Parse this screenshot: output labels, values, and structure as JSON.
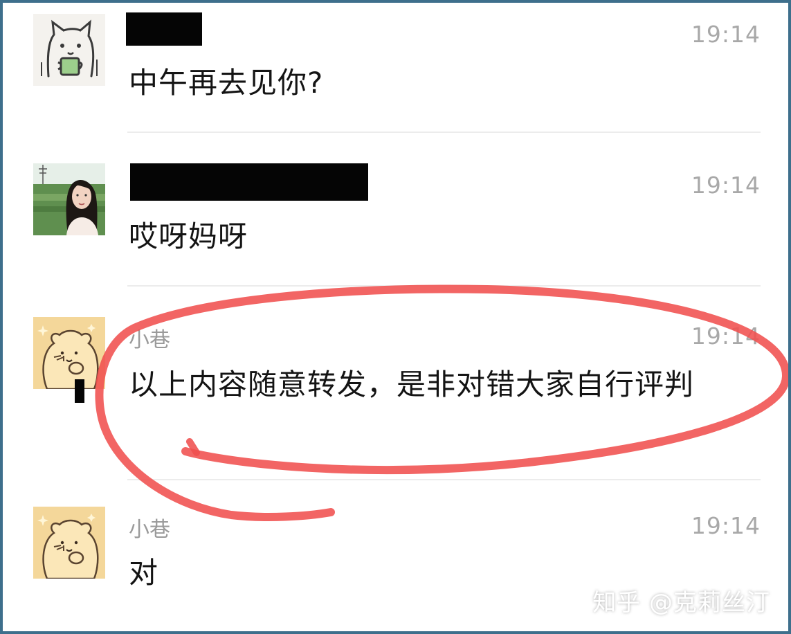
{
  "messages": [
    {
      "sender": "",
      "time": "19:14",
      "text": "中午再去见你?",
      "sender_redacted": true,
      "avatar_icon": "cat-cup-avatar-icon"
    },
    {
      "sender": "",
      "time": "19:14",
      "text": "哎呀妈呀",
      "sender_redacted": true,
      "avatar_icon": "woman-photo-avatar-icon"
    },
    {
      "sender": "小巷",
      "time": "19:14",
      "text": "以上内容随意转发，是非对错大家自行评判",
      "sender_redacted": false,
      "avatar_icon": "dog-cartoon-avatar-icon"
    },
    {
      "sender": "小巷",
      "time": "19:14",
      "text": "对",
      "sender_redacted": false,
      "avatar_icon": "dog-cartoon-avatar-icon"
    }
  ],
  "watermark": "知乎 @克莉丝汀",
  "colors": {
    "frame_border": "#3e6f8c",
    "highlight_ink": "#f0504f",
    "time_text": "#a8a8a8",
    "sender_text": "#9a9a9a",
    "message_text": "#141414"
  }
}
